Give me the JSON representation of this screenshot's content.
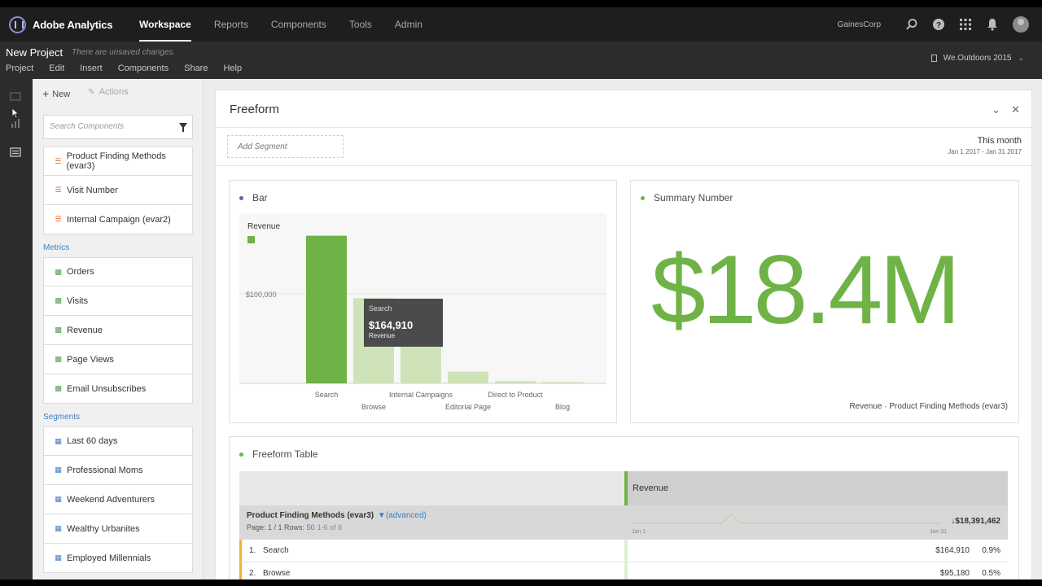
{
  "topnav": {
    "app_name": "Adobe Analytics",
    "items": [
      {
        "label": "Workspace",
        "active": true
      },
      {
        "label": "Reports",
        "active": false
      },
      {
        "label": "Components",
        "active": false
      },
      {
        "label": "Tools",
        "active": false
      },
      {
        "label": "Admin",
        "active": false
      }
    ],
    "company": "GainesCorp",
    "icons": [
      "search-icon",
      "help-icon",
      "apps-grid-icon",
      "notifications-bell-icon",
      "user-avatar"
    ]
  },
  "project": {
    "title": "New Project",
    "unsaved": "There are unsaved changes.",
    "menu": [
      "Project",
      "Edit",
      "Insert",
      "Components",
      "Share",
      "Help"
    ],
    "report_suite": "We.Outdoors 2015"
  },
  "panel": {
    "new_label": "New",
    "actions_label": "Actions",
    "search_placeholder": "Search Components",
    "dimensions": [
      "Product Finding Methods (evar3)",
      "Visit Number",
      "Internal Campaign (evar2)"
    ],
    "metrics_label": "Metrics",
    "metrics": [
      "Orders",
      "Visits",
      "Revenue",
      "Page Views",
      "Email Unsubscribes"
    ],
    "segments_label": "Segments",
    "segments": [
      "Last 60 days",
      "Professional Moms",
      "Weekend Adventurers",
      "Wealthy Urbanites",
      "Employed Millennials"
    ]
  },
  "freeform": {
    "title": "Freeform",
    "add_segment": "Add Segment",
    "date_label": "This month",
    "date_range": "Jan 1 2017 - Jan 31 2017"
  },
  "bar_viz": {
    "title": "Bar",
    "tooltip": {
      "category": "Search",
      "value": "$164,910",
      "metric": "Revenue"
    }
  },
  "chart_data": {
    "type": "bar",
    "legend": [
      "Revenue"
    ],
    "categories": [
      "Search",
      "Browse",
      "Internal Campaigns",
      "Editorial Page",
      "Direct to Product",
      "Blog"
    ],
    "values": [
      164910,
      95180,
      83000,
      13000,
      2500,
      1500
    ],
    "ylabel": "",
    "ytick_labels": [
      "$100,000"
    ],
    "ylim": [
      0,
      190000
    ],
    "highlighted": "Search",
    "colors": {
      "active": "#6fb346",
      "inactive": "#cfe3b8"
    }
  },
  "summary_viz": {
    "title": "Summary Number",
    "value": "$18.4M",
    "caption": "Revenue · Product Finding Methods (evar3)"
  },
  "table_viz": {
    "title": "Freeform Table",
    "column": "Revenue",
    "dimension": "Product Finding Methods (evar3)",
    "advanced": "(advanced)",
    "page_text": "Page: 1 / 1 Rows:",
    "rows_value": "50",
    "range_text": "1-6 of 6",
    "total": "$18,391,462",
    "spark_start": "Jan 1",
    "spark_end": "Jan 31",
    "rows": [
      {
        "num": "1.",
        "name": "Search",
        "value": "$164,910",
        "pct": "0.9%"
      },
      {
        "num": "2.",
        "name": "Browse",
        "value": "$95,180",
        "pct": "0.5%"
      }
    ]
  },
  "colors": {
    "accent_green": "#6fb346",
    "link_blue": "#3c7fc2",
    "dimension_orange": "#e0692a"
  }
}
